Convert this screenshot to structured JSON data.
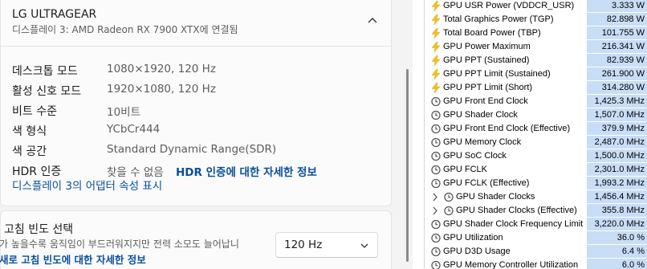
{
  "monitor": {
    "title": "LG ULTRAGEAR",
    "subtitle": "디스플레이 3: AMD Radeon RX 7900 XTX에 연결됨"
  },
  "properties": [
    {
      "label": "데스크톱 모드",
      "value": "1080×1920, 120 Hz"
    },
    {
      "label": "활성 신호 모드",
      "value": "1920×1080, 120 Hz"
    },
    {
      "label": "비트 수준",
      "value": "10비트"
    },
    {
      "label": "색 형식",
      "value": "YCbCr444"
    },
    {
      "label": "색 공간",
      "value": "Standard Dynamic Range(SDR)"
    },
    {
      "label": "HDR 인증",
      "value": "찾을 수 없음",
      "link": "HDR 인증에 대한 자세한 정보"
    }
  ],
  "adapter_link": "디스플레이 3의 어댑터 속성 표시",
  "refresh_rate": {
    "title": "고침 빈도 선택",
    "description": "가 높을수록 움직임이 부드러워지지만 전력 소모도 늘어납니",
    "link": "새로 고침 빈도에 대한 자세한 정보",
    "selected": "120 Hz"
  },
  "sensors": [
    {
      "icon": "power-bolt-icon",
      "name": "GPU USR Power (VDDCR_USR)",
      "value": "3.333 W"
    },
    {
      "icon": "power-bolt-icon",
      "name": "Total Graphics Power (TGP)",
      "value": "82.898 W"
    },
    {
      "icon": "power-bolt-icon",
      "name": "Total Board Power (TBP)",
      "value": "101.755 W"
    },
    {
      "icon": "power-bolt-icon",
      "name": "GPU Power Maximum",
      "value": "216.341 W"
    },
    {
      "icon": "power-bolt-icon",
      "name": "GPU PPT (Sustained)",
      "value": "82.939 W"
    },
    {
      "icon": "power-bolt-icon",
      "name": "GPU PPT Limit (Sustained)",
      "value": "261.900 W"
    },
    {
      "icon": "power-bolt-icon",
      "name": "GPU PPT Limit (Short)",
      "value": "314.280 W"
    },
    {
      "icon": "clock-icon",
      "name": "GPU Front End Clock",
      "value": "1,425.3 MHz"
    },
    {
      "icon": "clock-icon",
      "name": "GPU Shader Clock",
      "value": "1,507.0 MHz"
    },
    {
      "icon": "clock-icon",
      "name": "GPU Front End Clock (Effective)",
      "value": "379.9 MHz"
    },
    {
      "icon": "clock-icon",
      "name": "GPU Memory Clock",
      "value": "2,487.0 MHz"
    },
    {
      "icon": "clock-icon",
      "name": "GPU SoC Clock",
      "value": "1,500.0 MHz"
    },
    {
      "icon": "clock-icon",
      "name": "GPU FCLK",
      "value": "2,301.0 MHz"
    },
    {
      "icon": "clock-icon",
      "name": "GPU FCLK (Effective)",
      "value": "1,993.2 MHz"
    },
    {
      "icon": "clock-icon",
      "name": "GPU Shader Clocks",
      "value": "1,456.4 MHz",
      "expandable": true
    },
    {
      "icon": "clock-icon",
      "name": "GPU Shader Clocks (Effective)",
      "value": "355.8 MHz",
      "expandable": true
    },
    {
      "icon": "clock-icon",
      "name": "GPU Shader Clock Frequency Limit",
      "value": "3,220.0 MHz"
    },
    {
      "icon": "clock-icon",
      "name": "GPU Utilization",
      "value": "36.0 %"
    },
    {
      "icon": "clock-icon",
      "name": "GPU D3D Usage",
      "value": "6.4 %"
    },
    {
      "icon": "clock-icon",
      "name": "GPU Memory Controller Utilization",
      "value": "6.0 %"
    }
  ],
  "colors": {
    "link": "#0a4f9e",
    "value_highlight": "#c8ddf6",
    "bolt": "#f2c21b"
  }
}
